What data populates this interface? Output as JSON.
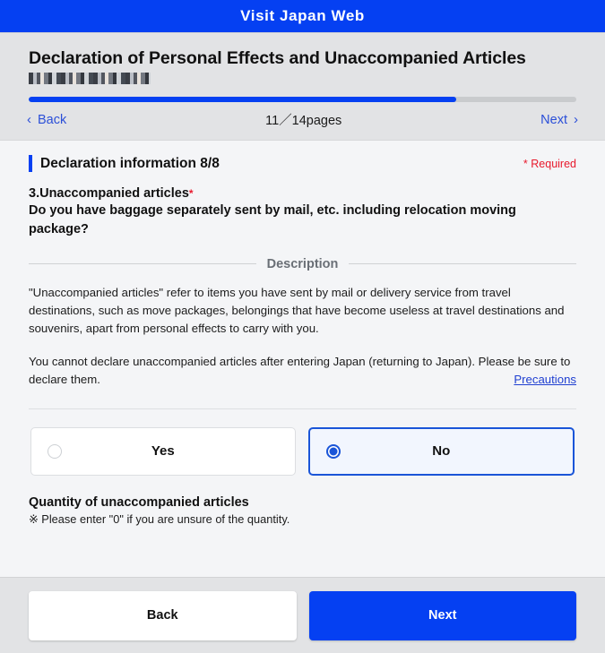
{
  "app": {
    "title": "Visit Japan Web",
    "brand_color": "#0540f2"
  },
  "header": {
    "page_title": "Declaration of Personal Effects and Unaccompanied Articles",
    "redacted_subtitle": "",
    "progress_percent": 78,
    "pager": {
      "back_label": "Back",
      "back_chevron": "‹",
      "count_label": "11／14pages",
      "next_label": "Next",
      "next_chevron": "›"
    }
  },
  "main": {
    "section_title": "Declaration information 8/8",
    "required_note": "* Required",
    "question": {
      "number_label": "3.Unaccompanied articles",
      "required_asterisk": "*",
      "text": "Do you have baggage separately sent by mail, etc. including relocation moving package?"
    },
    "description": {
      "heading": "Description",
      "paragraph1": "\"Unaccompanied articles\" refer to items you have sent by mail or delivery service from travel destinations, such as move packages, belongings that have become useless at travel destinations and souvenirs, apart from personal effects to carry with you.",
      "paragraph2": "You cannot declare unaccompanied articles after entering Japan (returning to Japan). Please be sure to declare them.",
      "link_label": "Precautions",
      "link_color": "#1f3fd1"
    },
    "choices": [
      {
        "label": "Yes",
        "selected": false
      },
      {
        "label": "No",
        "selected": true
      }
    ],
    "quantity": {
      "title": "Quantity of unaccompanied articles",
      "note": "※ Please enter \"0\" if you are unsure of the quantity."
    }
  },
  "footer": {
    "back_label": "Back",
    "next_label": "Next"
  }
}
